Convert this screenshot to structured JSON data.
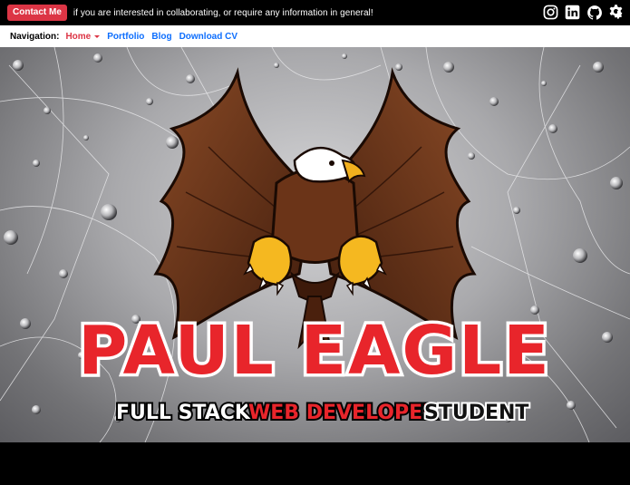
{
  "topbar": {
    "contact_label": "Contact Me",
    "message": "if you are interested in collaborating, or require any information in general!",
    "social": [
      {
        "icon": "instagram-icon"
      },
      {
        "icon": "linkedin-icon"
      },
      {
        "icon": "github-icon"
      },
      {
        "icon": "settings-gear-icon"
      }
    ]
  },
  "nav": {
    "label": "Navigation:",
    "items": [
      {
        "label": "Home",
        "active": true,
        "dropdown": true
      },
      {
        "label": "Portfolio"
      },
      {
        "label": "Blog"
      },
      {
        "label": "Download CV"
      }
    ]
  },
  "hero": {
    "title": "PAUL EAGLE",
    "subtitle_part1": "FULL STACK",
    "subtitle_part2": "WEB DEVELOPER",
    "subtitle_part3": "STUDENT",
    "colors": {
      "title_red": "#e8252b",
      "accent_red": "#dc3545",
      "link_blue": "#0d6efd"
    }
  }
}
